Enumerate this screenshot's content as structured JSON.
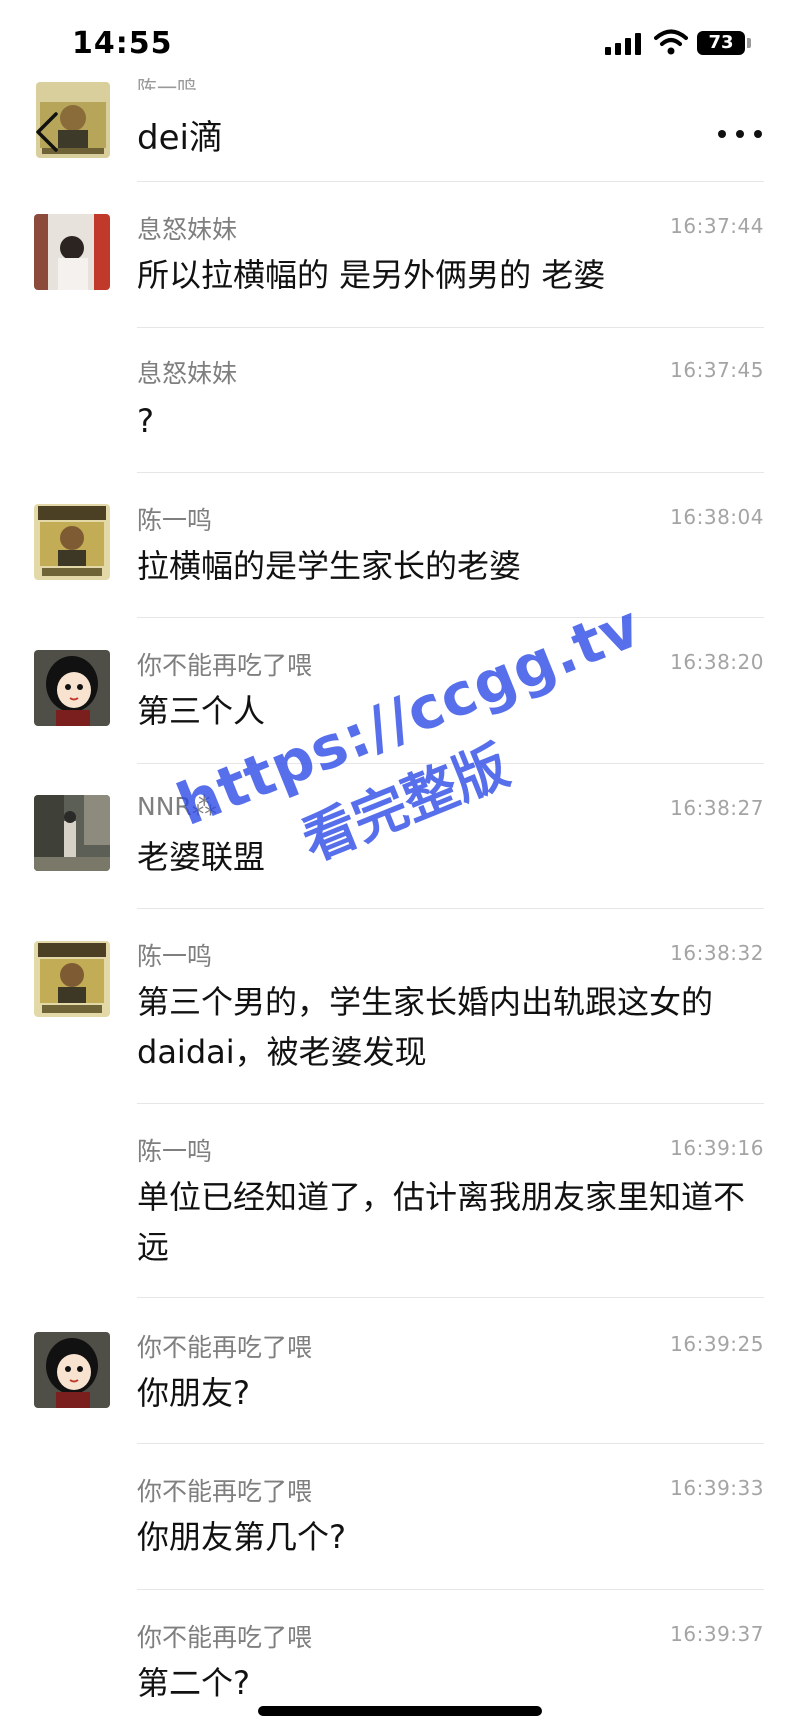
{
  "status_bar": {
    "time": "14:55",
    "battery": "73",
    "icons": [
      "signal-icon",
      "wifi-icon",
      "battery-icon"
    ]
  },
  "header": {
    "title": "dei滴",
    "subtitle": "陈一鸣",
    "back_icon": "chevron-left-icon",
    "more_icon": "more-icon"
  },
  "messages": [
    {
      "sender": "息怒妹妹",
      "time": "16:37:44",
      "text": "所以拉横幅的 是另外俩男的 老婆",
      "avatar": "photo-girl"
    },
    {
      "sender": "息怒妹妹",
      "time": "16:37:45",
      "text": "?",
      "avatar": ""
    },
    {
      "sender": "陈一鸣",
      "time": "16:38:04",
      "text": "拉横幅的是学生家长的老婆",
      "avatar": "wanted-poster"
    },
    {
      "sender": "你不能再吃了喂",
      "time": "16:38:20",
      "text": "第三个人",
      "avatar": "cartoon-girl"
    },
    {
      "sender": "NNR⁂",
      "time": "16:38:27",
      "text": "老婆联盟",
      "avatar": "photo-street"
    },
    {
      "sender": "陈一鸣",
      "time": "16:38:32",
      "text": "第三个男的，学生家长婚内出轨跟这女的daidai，被老婆发现",
      "avatar": "wanted-poster"
    },
    {
      "sender": "陈一鸣",
      "time": "16:39:16",
      "text": "单位已经知道了，估计离我朋友家里知道不远",
      "avatar": ""
    },
    {
      "sender": "你不能再吃了喂",
      "time": "16:39:25",
      "text": "你朋友?",
      "avatar": "cartoon-girl"
    },
    {
      "sender": "你不能再吃了喂",
      "time": "16:39:33",
      "text": "你朋友第几个?",
      "avatar": ""
    },
    {
      "sender": "你不能再吃了喂",
      "time": "16:39:37",
      "text": "第二个?",
      "avatar": ""
    }
  ],
  "watermark": {
    "url": "https://ccgg.tv",
    "caption": "看完整版"
  },
  "colors": {
    "watermark": "#2846e6",
    "sender": "#7f7f7f",
    "time": "#a4a4a4",
    "divider": "#e6e6e6"
  }
}
